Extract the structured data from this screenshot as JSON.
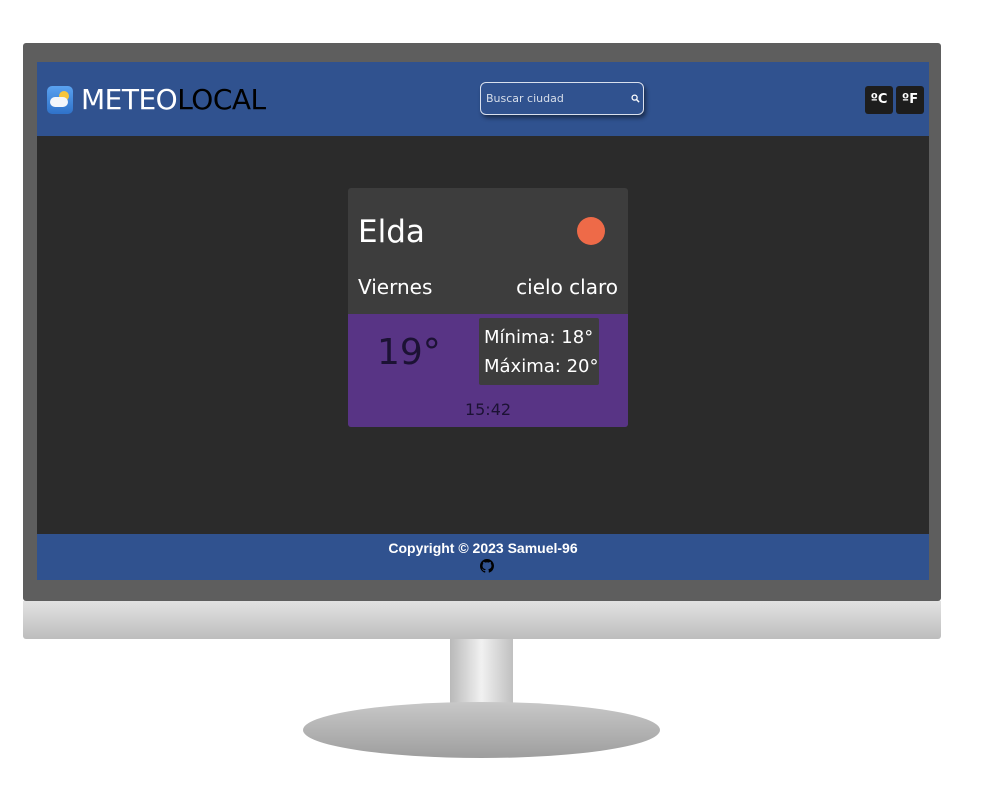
{
  "header": {
    "brand_part1": "METEO",
    "brand_part2": "LOCAL",
    "logo_icon": "weather-app-logo-icon",
    "search": {
      "placeholder": "Buscar ciudad",
      "value": "",
      "icon": "search-icon"
    },
    "units": [
      {
        "label": "ºC"
      },
      {
        "label": "ºF"
      }
    ]
  },
  "weather": {
    "city": "Elda",
    "icon": "clear-sky-sun-icon",
    "day": "Viernes",
    "description": "cielo claro",
    "temperature": "19°",
    "min": "Mínima: 18°",
    "max": "Máxima: 20°",
    "time": "15:42"
  },
  "footer": {
    "copyright": "Copyright © 2023 Samuel-96",
    "github_icon": "github-icon"
  },
  "colors": {
    "header_footer_bg": "#30528f",
    "page_bg": "#2b2b2b",
    "card_bg": "#3d3d3d",
    "temp_panel_bg": "#583485",
    "sun_icon": "#ee6a48"
  }
}
